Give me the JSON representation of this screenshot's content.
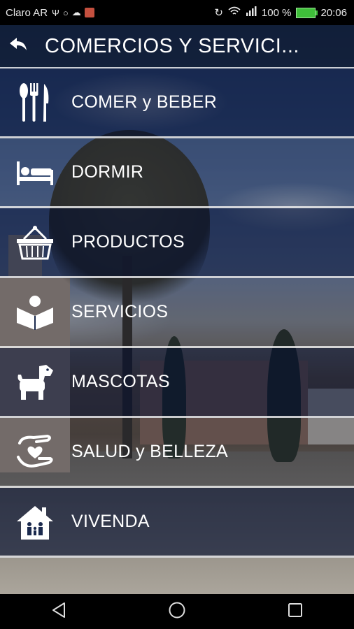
{
  "status_bar": {
    "carrier": "Claro AR",
    "battery": "100 %",
    "time": "20:06",
    "left_icons": [
      "usb-icon",
      "whatsapp-icon",
      "cloud-icon",
      "app-icon"
    ],
    "right_icons": [
      "sync-icon",
      "wifi-icon",
      "signal-icon",
      "battery-icon"
    ]
  },
  "header": {
    "title": "COMERCIOS Y SERVICI...",
    "back_icon": "back-arrow-icon"
  },
  "menu": {
    "items": [
      {
        "label": "COMER y BEBER",
        "icon": "cutlery-icon"
      },
      {
        "label": "DORMIR",
        "icon": "bed-icon"
      },
      {
        "label": "PRODUCTOS",
        "icon": "basket-icon"
      },
      {
        "label": "SERVICIOS",
        "icon": "open-book-icon"
      },
      {
        "label": "MASCOTAS",
        "icon": "dog-icon"
      },
      {
        "label": "SALUD y BELLEZA",
        "icon": "caring-hands-icon"
      },
      {
        "label": "VIVENDA",
        "icon": "house-family-icon"
      }
    ]
  },
  "nav_bar": {
    "buttons": [
      "back-triangle-icon",
      "home-circle-icon",
      "recents-square-icon"
    ]
  },
  "colors": {
    "status_bar": "#000000",
    "battery_green": "#3fbf3a",
    "text": "#ffffff",
    "divider": "#ebebeb"
  }
}
